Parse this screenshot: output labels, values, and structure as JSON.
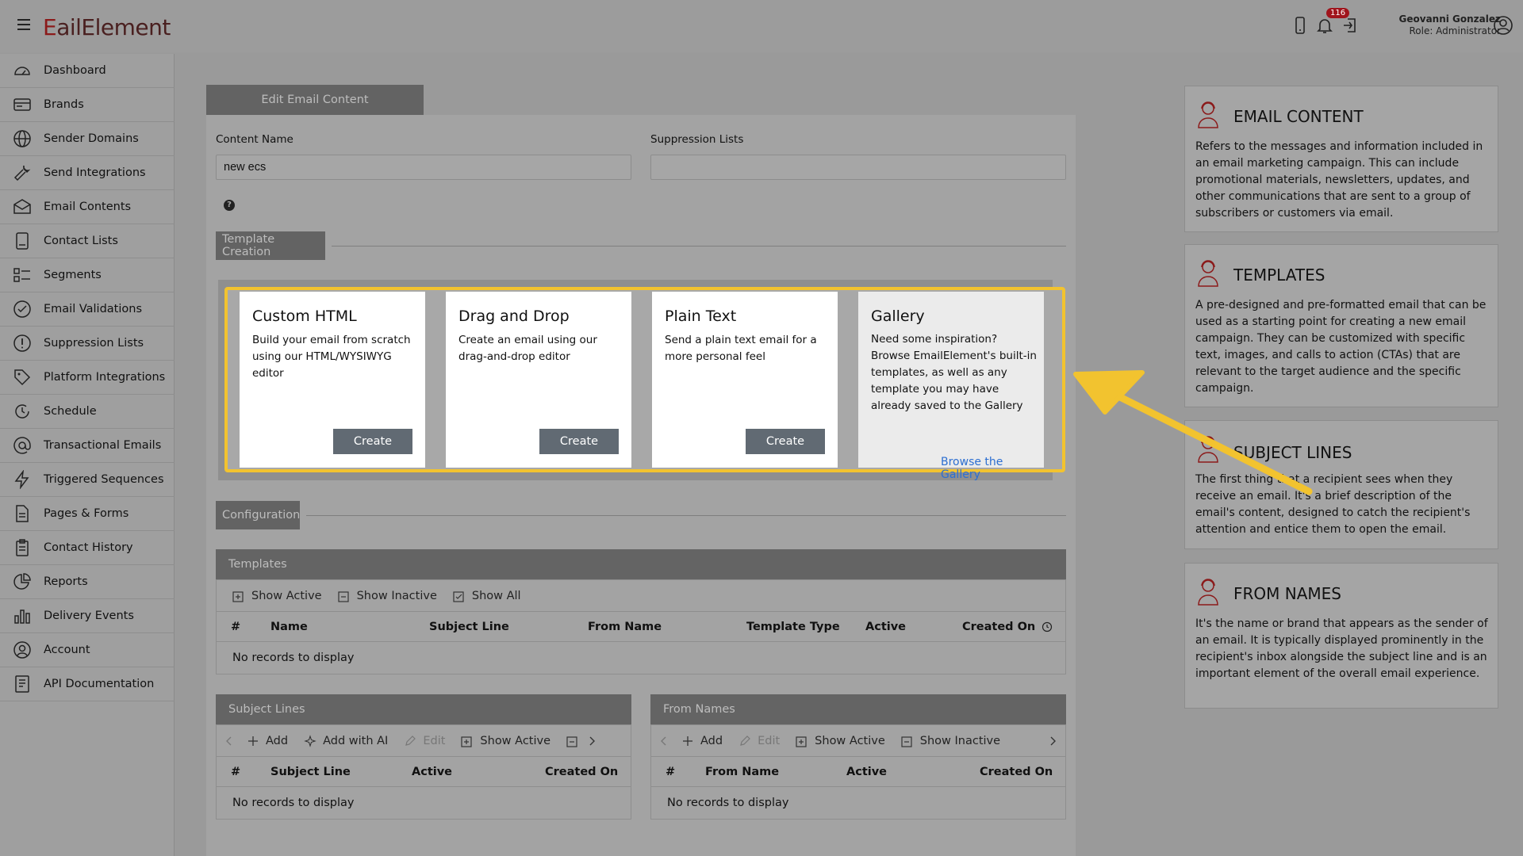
{
  "header": {
    "logo_left": "E",
    "logo_right": "ailElement",
    "notification_count": "116",
    "user_name": "Geovanni Gonzalez",
    "user_role": "Role: Administrator"
  },
  "sidebar": {
    "items": [
      {
        "label": "Dashboard",
        "icon": "dashboard-icon"
      },
      {
        "label": "Brands",
        "icon": "brands-icon"
      },
      {
        "label": "Sender Domains",
        "icon": "globe-icon"
      },
      {
        "label": "Send Integrations",
        "icon": "wrench-icon"
      },
      {
        "label": "Email Contents",
        "icon": "envelope-icon"
      },
      {
        "label": "Contact Lists",
        "icon": "contact-list-icon"
      },
      {
        "label": "Segments",
        "icon": "segments-icon"
      },
      {
        "label": "Email Validations",
        "icon": "check-circle-icon"
      },
      {
        "label": "Suppression Lists",
        "icon": "exclamation-circle-icon"
      },
      {
        "label": "Platform Integrations",
        "icon": "tag-icon"
      },
      {
        "label": "Schedule",
        "icon": "schedule-icon"
      },
      {
        "label": "Transactional Emails",
        "icon": "at-icon"
      },
      {
        "label": "Triggered Sequences",
        "icon": "lightning-icon"
      },
      {
        "label": "Pages & Forms",
        "icon": "document-icon"
      },
      {
        "label": "Contact History",
        "icon": "clipboard-icon"
      },
      {
        "label": "Reports",
        "icon": "pie-chart-icon"
      },
      {
        "label": "Delivery Events",
        "icon": "bar-chart-icon"
      },
      {
        "label": "Account",
        "icon": "account-icon"
      },
      {
        "label": "API Documentation",
        "icon": "api-doc-icon"
      }
    ]
  },
  "main": {
    "tab_label": "Edit Email Content",
    "content_name_label": "Content Name",
    "content_name_value": "new ecs",
    "suppression_label": "Suppression Lists",
    "suppression_value": "",
    "template_creation_label": "Template Creation",
    "configuration_label": "Configuration",
    "templates": [
      {
        "title": "Custom HTML",
        "desc": "Build your email from scratch using our HTML/WYSIWYG editor",
        "button": "Create"
      },
      {
        "title": "Drag and Drop",
        "desc": "Create an email using our drag-and-drop editor",
        "button": "Create"
      },
      {
        "title": "Plain Text",
        "desc": "Send a plain text email for a more personal feel",
        "button": "Create"
      }
    ],
    "gallery": {
      "title": "Gallery",
      "desc": "Need some inspiration? Browse EmailElement's built-in templates, as well as any template you may have already saved to the Gallery",
      "link": "Browse the Gallery"
    }
  },
  "templates_table": {
    "title": "Templates",
    "tools": [
      "Show Active",
      "Show Inactive",
      "Show All"
    ],
    "columns": [
      "#",
      "Name",
      "Subject Line",
      "From Name",
      "Template Type",
      "Active",
      "Created On"
    ],
    "empty": "No records to display"
  },
  "subject_table": {
    "title": "Subject Lines",
    "tools": [
      "Add",
      "Add with AI",
      "Edit",
      "Show Active"
    ],
    "columns": [
      "#",
      "Subject Line",
      "Active",
      "Created On"
    ],
    "empty": "No records to display"
  },
  "from_table": {
    "title": "From Names",
    "tools": [
      "Add",
      "Edit",
      "Show Active",
      "Show Inactive"
    ],
    "columns": [
      "#",
      "From Name",
      "Active",
      "Created On"
    ],
    "empty": "No records to display"
  },
  "info_cards": [
    {
      "title": "EMAIL CONTENT",
      "body": "Refers to the messages and information included in an email marketing campaign. This can include promotional materials, newsletters, updates, and other communications that are sent to a group of subscribers or customers via email."
    },
    {
      "title": "TEMPLATES",
      "body": "A pre-designed and pre-formatted email that can be used as a starting point for creating a new email campaign. They can be customized with specific text, images, and calls to action (CTAs) that are relevant to the target audience and the specific campaign."
    },
    {
      "title": "SUBJECT LINES",
      "body": "The first thing that a recipient sees when they receive an email. It's a brief description of the email's content, designed to catch the recipient's attention and entice them to open the email."
    },
    {
      "title": "FROM NAMES",
      "body": "It's the name or brand that appears as the sender of an email. It is typically displayed prominently in the recipient's inbox alongside the subject line and is an important element of the overall email experience."
    }
  ],
  "colors": {
    "accent_highlight": "#f2c32f",
    "button": "#616a73",
    "link": "#2d6fd1",
    "badge": "#a0141c",
    "brand": "#8b1a1a"
  }
}
